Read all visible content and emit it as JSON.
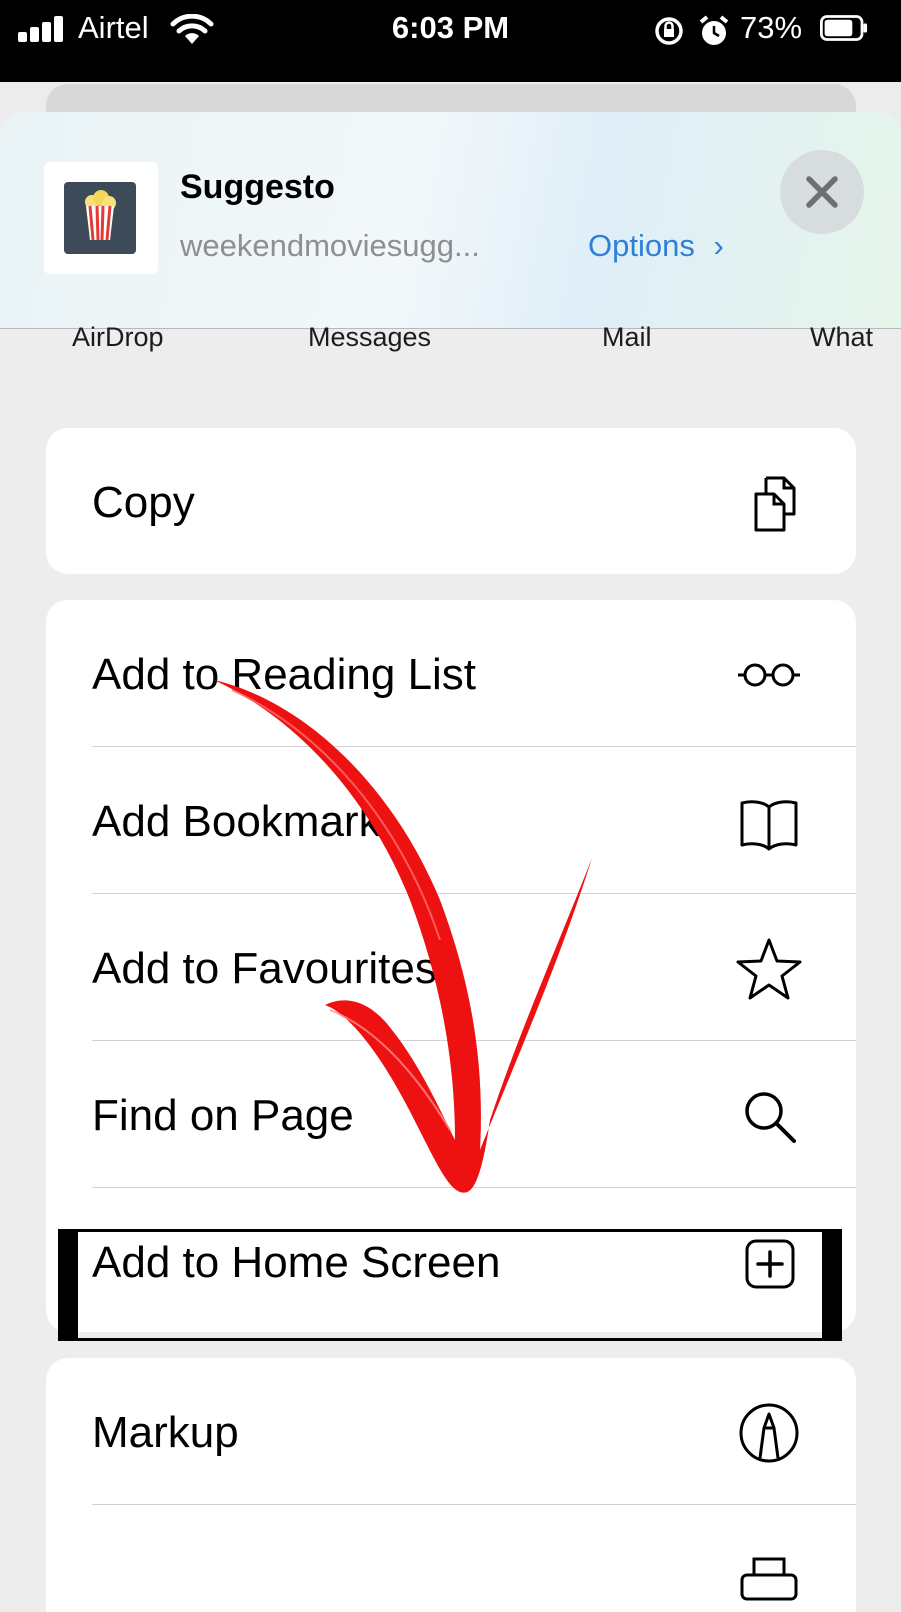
{
  "status_bar": {
    "carrier": "Airtel",
    "time": "6:03 PM",
    "battery_percent": "73%"
  },
  "share_header": {
    "app_name": "Suggesto",
    "url": "weekendmoviesugg...",
    "options_label": "Options",
    "options_chevron": "›"
  },
  "share_targets": [
    "AirDrop",
    "Messages",
    "Mail",
    "What"
  ],
  "actions": {
    "copy": "Copy",
    "add_reading_list": "Add to Reading List",
    "add_bookmark": "Add Bookmark",
    "add_favourites": "Add to Favourites",
    "find_on_page": "Find on Page",
    "add_home_screen": "Add to Home Screen",
    "markup": "Markup"
  },
  "icons": {
    "copy": "copy-icon",
    "reading_list": "glasses-icon",
    "bookmark": "book-icon",
    "favourites": "star-icon",
    "find": "search-icon",
    "home_screen": "plus-square-icon",
    "markup": "markup-pen-icon"
  },
  "colors": {
    "accent": "#2f7fd9",
    "arrow": "#ee1111"
  }
}
